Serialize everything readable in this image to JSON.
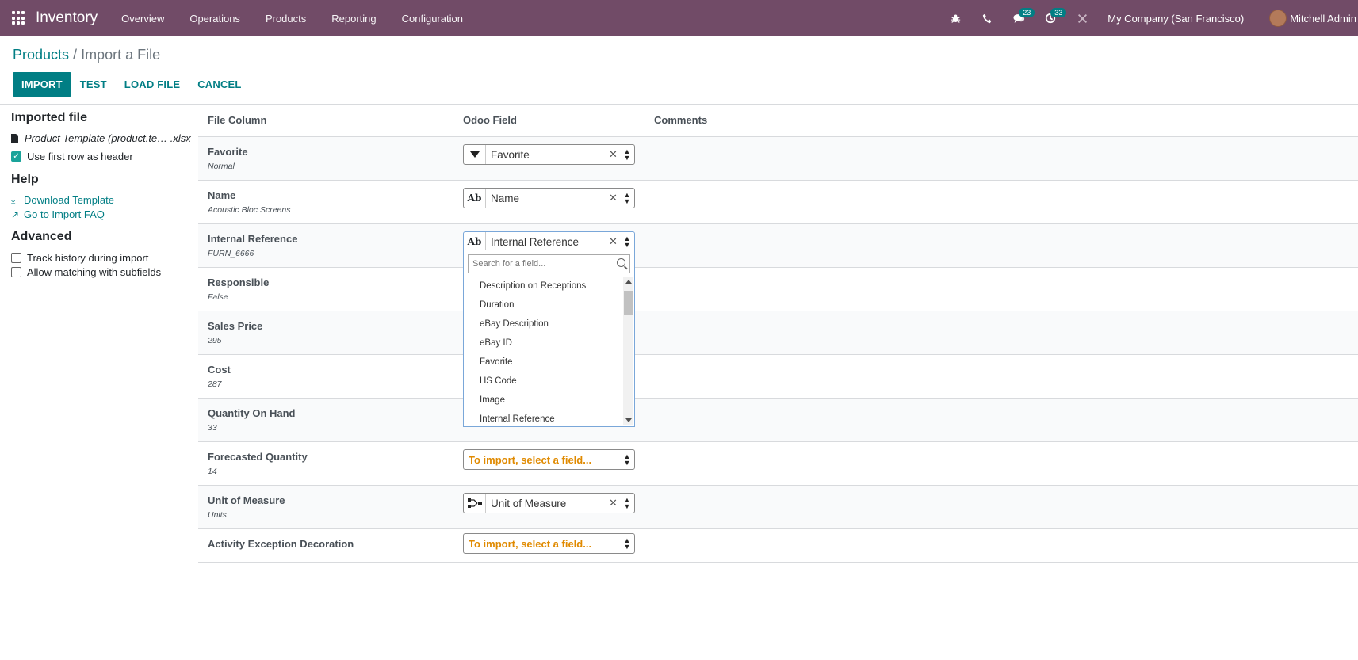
{
  "nav": {
    "app_name": "Inventory",
    "menu": [
      "Overview",
      "Operations",
      "Products",
      "Reporting",
      "Configuration"
    ],
    "messages_count": "23",
    "activities_count": "33",
    "company": "My Company (San Francisco)",
    "user": "Mitchell Admin"
  },
  "breadcrumb": {
    "parent": "Products",
    "separator": " / ",
    "current": "Import a File"
  },
  "buttons": {
    "import": "IMPORT",
    "test": "TEST",
    "load_file": "LOAD FILE",
    "cancel": "CANCEL"
  },
  "sidebar": {
    "imported_heading": "Imported file",
    "file_name": "Product Template (product.te… .xlsx",
    "use_header_label": "Use first row as header",
    "use_header_checked": true,
    "help_heading": "Help",
    "download_template": "Download Template",
    "import_faq": "Go to Import FAQ",
    "advanced_heading": "Advanced",
    "track_history": "Track history during import",
    "allow_matching": "Allow matching with subfields"
  },
  "table": {
    "headers": {
      "file_column": "File Column",
      "odoo_field": "Odoo Field",
      "comments": "Comments"
    },
    "rows": [
      {
        "name": "Favorite",
        "sample": "Normal",
        "field": "Favorite",
        "type": "selection"
      },
      {
        "name": "Name",
        "sample": "Acoustic Bloc Screens",
        "field": "Name",
        "type": "text"
      },
      {
        "name": "Internal Reference",
        "sample": "FURN_6666",
        "field": "Internal Reference",
        "type": "text"
      },
      {
        "name": "Responsible",
        "sample": "False",
        "field": "",
        "type": ""
      },
      {
        "name": "Sales Price",
        "sample": "295",
        "field": "",
        "type": ""
      },
      {
        "name": "Cost",
        "sample": "287",
        "field": "",
        "type": ""
      },
      {
        "name": "Quantity On Hand",
        "sample": "33",
        "field": "",
        "type": ""
      },
      {
        "name": "Forecasted Quantity",
        "sample": "14",
        "field": "To import, select a field...",
        "type": "none"
      },
      {
        "name": "Unit of Measure",
        "sample": "Units",
        "field": "Unit of Measure",
        "type": "relation"
      },
      {
        "name": "Activity Exception Decoration",
        "sample": "",
        "field": "To import, select a field...",
        "type": "none"
      }
    ],
    "type_text_label": "Ab"
  },
  "dropdown": {
    "search_placeholder": "Search for a field...",
    "items": [
      "Description on Receptions",
      "Duration",
      "eBay Description",
      "eBay ID",
      "Favorite",
      "HS Code",
      "Image",
      "Internal Reference"
    ]
  }
}
